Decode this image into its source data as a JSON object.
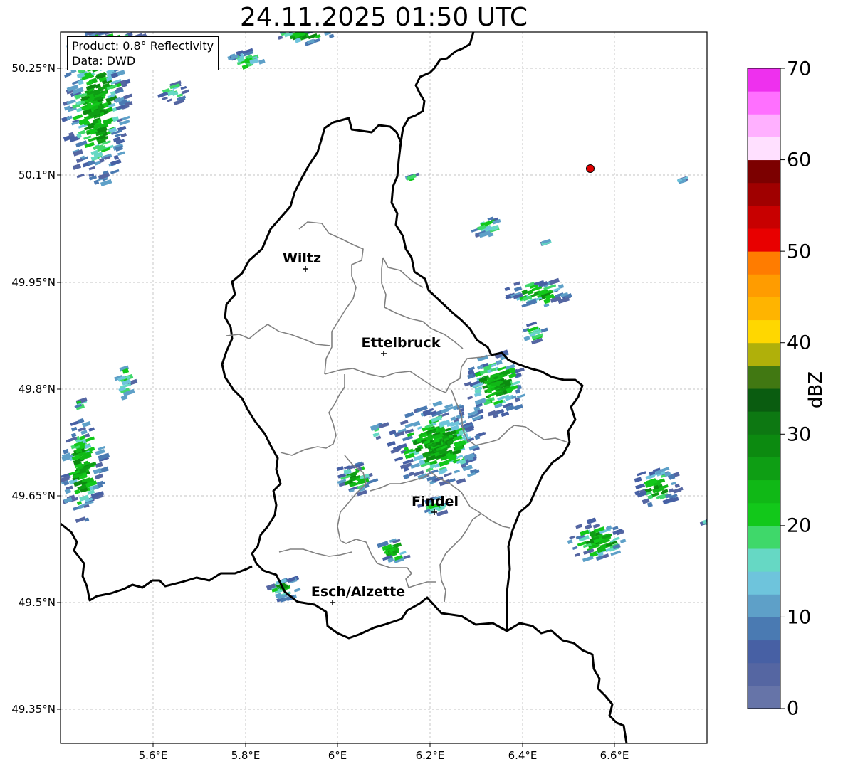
{
  "title": "24.11.2025 01:50 UTC",
  "legend": {
    "line1": "Product: 0.8° Reflectivity",
    "line2": "Data: DWD"
  },
  "lat_labels": [
    "50.25°N",
    "50.1°N",
    "49.95°N",
    "49.8°N",
    "49.65°N",
    "49.5°N",
    "49.35°N"
  ],
  "lon_labels": [
    "5.6°E",
    "5.8°E",
    "6°E",
    "6.2°E",
    "6.4°E",
    "6.6°E"
  ],
  "places": [
    "Wiltz",
    "Ettelbruck",
    "Findel",
    "Esch/Alzette"
  ],
  "colorbar": {
    "label": "dBZ",
    "ticks": [
      "0",
      "10",
      "20",
      "30",
      "40",
      "50",
      "60",
      "70"
    ],
    "colors": [
      "#6674a8",
      "#5566a2",
      "#4760a4",
      "#4a7ab2",
      "#5ea0c8",
      "#6ec4dc",
      "#66d8c4",
      "#3fd86a",
      "#12c81a",
      "#10b816",
      "#0e9e14",
      "#0c8a10",
      "#0d7812",
      "#0a5c10",
      "#417812",
      "#b0b00a",
      "#ffd700",
      "#ffb400",
      "#ff9c00",
      "#ff7c00",
      "#e80000",
      "#c80000",
      "#a00000",
      "#7c0000",
      "#ffe0ff",
      "#ffb0ff",
      "#ff70ff",
      "#ee30ee"
    ]
  },
  "styles": {
    "border_color": "#000000",
    "district_color": "#808080",
    "marker_color": "#e00000"
  }
}
